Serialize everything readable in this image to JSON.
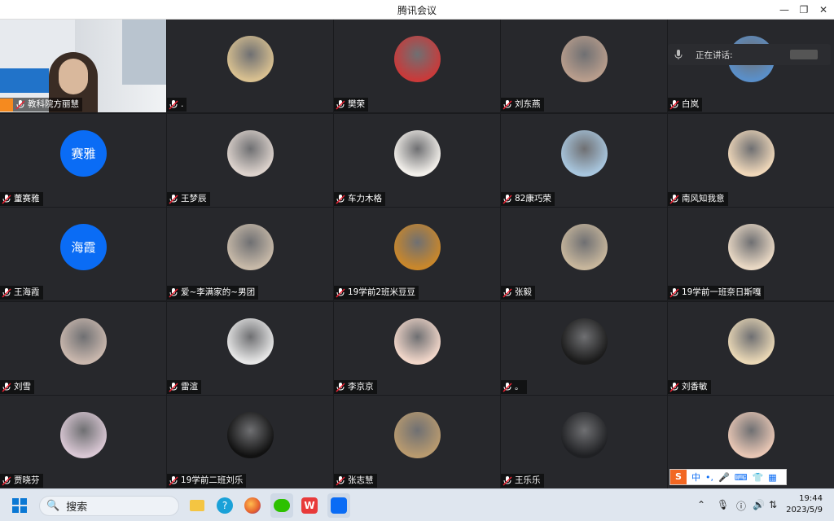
{
  "window": {
    "title": "腾讯会议",
    "minimize": "—",
    "restore": "❐",
    "close": "✕"
  },
  "speaking": {
    "label": "正在讲话:"
  },
  "participants": [
    {
      "name": "教科院方丽慧",
      "kind": "video"
    },
    {
      "name": ".",
      "kind": "photo",
      "color": "#d8c090"
    },
    {
      "name": "樊荣",
      "kind": "photo",
      "color": "#c93a3a"
    },
    {
      "name": "刘东燕",
      "kind": "photo",
      "color": "#b89d8c"
    },
    {
      "name": "白岚",
      "kind": "photo",
      "color": "#5a8fc9"
    },
    {
      "name": "董赛雅",
      "kind": "text",
      "initials": "赛雅"
    },
    {
      "name": "王梦辰",
      "kind": "photo",
      "color": "#dcd2cc"
    },
    {
      "name": "车力木格",
      "kind": "photo",
      "color": "#f2efea"
    },
    {
      "name": "82康巧荣",
      "kind": "photo",
      "color": "#a8c6de"
    },
    {
      "name": "南风知我意",
      "kind": "photo",
      "color": "#efd7b9"
    },
    {
      "name": "王海霞",
      "kind": "text",
      "initials": "海霞"
    },
    {
      "name": "爱~李满家的~男团",
      "kind": "photo",
      "color": "#c7b9a8"
    },
    {
      "name": "19学前2班米豆豆",
      "kind": "photo",
      "color": "#c9872b"
    },
    {
      "name": "张毅",
      "kind": "photo",
      "color": "#c7b69c"
    },
    {
      "name": "19学前一班奈日斯嘎",
      "kind": "photo",
      "color": "#e9d8c4"
    },
    {
      "name": "刘雪",
      "kind": "photo",
      "color": "#c9b7ad"
    },
    {
      "name": "雷渲",
      "kind": "photo",
      "color": "#e6e6e6"
    },
    {
      "name": "李京京",
      "kind": "photo",
      "color": "#f1d6c9"
    },
    {
      "name": "。",
      "kind": "photo",
      "color": "#1b1b1b"
    },
    {
      "name": "刘香敏",
      "kind": "photo",
      "color": "#e9d7b5"
    },
    {
      "name": "贾晓芬",
      "kind": "photo",
      "color": "#d9c7d4"
    },
    {
      "name": "19学前二班刘乐",
      "kind": "photo",
      "color": "#111111"
    },
    {
      "name": "张志慧",
      "kind": "photo",
      "color": "#b89a6f"
    },
    {
      "name": "王乐乐",
      "kind": "blank",
      "color": "#1f2023"
    },
    {
      "name": "",
      "kind": "photo",
      "color": "#e8c6b4"
    }
  ],
  "ime": {
    "s": "S",
    "lang": "中",
    "punct": "•,"
  },
  "taskbar": {
    "search_label": "搜索",
    "time": "19:44",
    "date": "2023/5/9"
  },
  "icons": {
    "mic": "mic-icon",
    "user": "user-icon",
    "start": "windows-start-icon"
  }
}
